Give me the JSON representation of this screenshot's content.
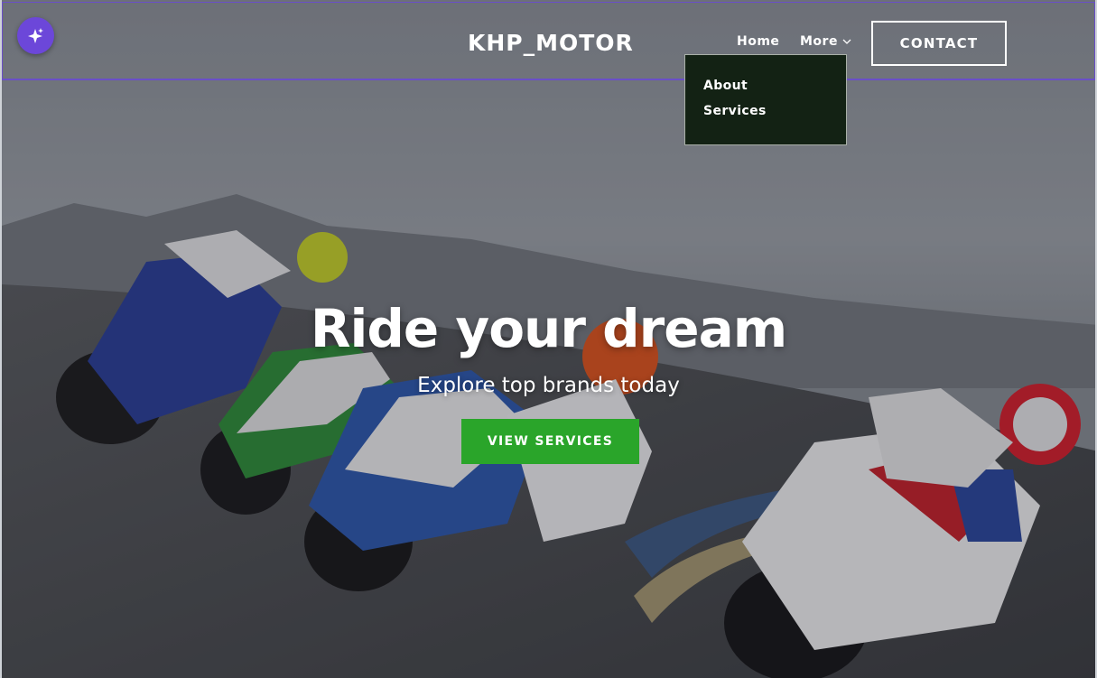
{
  "brand": "KHP_MOTOR",
  "nav": {
    "home_label": "Home",
    "more_label": "More",
    "dropdown_items": [
      "About",
      "Services"
    ]
  },
  "contact_label": "CONTACT",
  "hero": {
    "title": "Ride your dream",
    "subtitle": "Explore top brands today",
    "cta_label": "VIEW SERVICES"
  },
  "colors": {
    "accent_green": "#2aa52a",
    "ai_badge": "#6c47d9",
    "dropdown_bg": "#132214"
  },
  "icons": {
    "ai_badge": "sparkle-icon",
    "more_caret": "chevron-down-icon"
  }
}
